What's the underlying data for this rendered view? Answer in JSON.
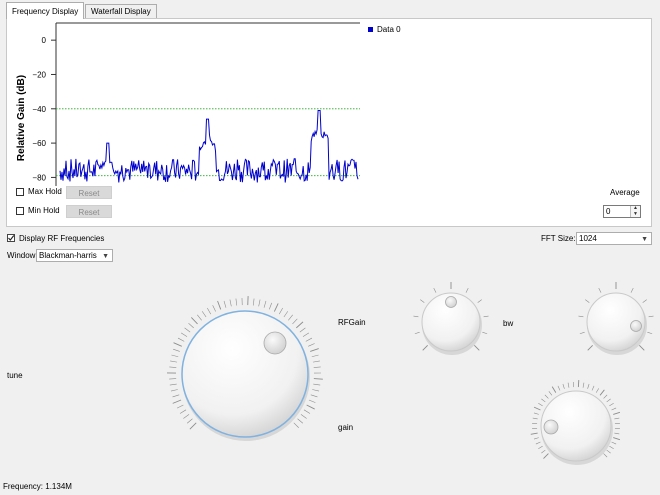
{
  "tabs": [
    {
      "label": "Frequency Display",
      "active": true
    },
    {
      "label": "Waterfall Display",
      "active": false
    }
  ],
  "chart_data": {
    "type": "line",
    "ylabel": "Relative Gain (dB)",
    "ylim": [
      -85,
      10
    ],
    "yticks": [
      "0",
      "−20",
      "−40",
      "−60",
      "−80"
    ],
    "ytick_values": [
      0,
      -20,
      -40,
      -60,
      -80
    ],
    "reference_lines": [
      {
        "value": -40,
        "color": "#22aa22",
        "style": "dotted"
      },
      {
        "value": -79,
        "color": "#22aa22",
        "style": "dotted"
      }
    ],
    "legend": "top-right",
    "series": [
      {
        "name": "Data 0",
        "color": "#0000cc"
      }
    ],
    "peaks": [
      {
        "position": 0.16,
        "value": -60
      },
      {
        "position": 0.495,
        "value": -46
      },
      {
        "position": 0.87,
        "value": -41
      }
    ]
  },
  "controls": {
    "max_hold_label": "Max Hold",
    "min_hold_label": "Min Hold",
    "reset_label": "Reset",
    "average_label": "Average",
    "average_value": "0",
    "display_rf_label": "Display RF Frequencies",
    "display_rf_checked": true,
    "fft_size_label": "FFT Size:",
    "fft_size_value": "1024",
    "window_label": "Window:",
    "window_value": "Blackman-harris"
  },
  "knobs": {
    "tune_label": "tune",
    "rfgain_label": "RFGain",
    "gain_label": "gain",
    "bw_label": "bw"
  },
  "status": {
    "frequency": "Frequency: 1.134M"
  }
}
